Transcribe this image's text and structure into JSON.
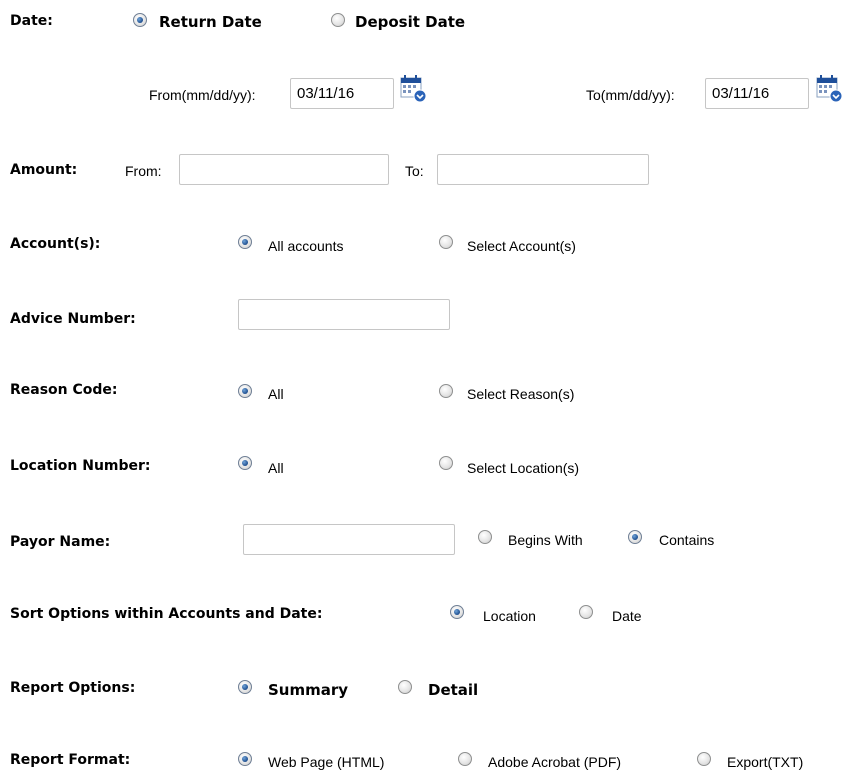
{
  "date": {
    "label": "Date:",
    "options": [
      "Return Date",
      "Deposit Date"
    ],
    "selected": "Return Date",
    "from_label": "From(mm/dd/yy):",
    "from_value": "03/11/16",
    "to_label": "To(mm/dd/yy):",
    "to_value": "03/11/16",
    "calendar_icon": "calendar-icon"
  },
  "amount": {
    "label": "Amount:",
    "from_label": "From:",
    "from_value": "",
    "to_label": "To:",
    "to_value": ""
  },
  "accounts": {
    "label": "Account(s):",
    "options": [
      "All accounts",
      "Select Account(s)"
    ],
    "selected": "All accounts"
  },
  "advice": {
    "label": "Advice Number:",
    "value": ""
  },
  "reason": {
    "label": "Reason Code:",
    "options": [
      "All",
      "Select Reason(s)"
    ],
    "selected": "All"
  },
  "location": {
    "label": "Location Number:",
    "options": [
      "All",
      "Select Location(s)"
    ],
    "selected": "All"
  },
  "payor": {
    "label": "Payor Name:",
    "value": "",
    "options": [
      "Begins With",
      "Contains"
    ],
    "selected": "Contains"
  },
  "sort": {
    "label": "Sort Options within Accounts and Date:",
    "options": [
      "Location",
      "Date"
    ],
    "selected": "Location"
  },
  "report_options": {
    "label": "Report Options:",
    "options": [
      "Summary",
      "Detail"
    ],
    "selected": "Summary"
  },
  "report_format": {
    "label": "Report Format:",
    "options": [
      "Web Page (HTML)",
      "Adobe Acrobat (PDF)",
      "Export(TXT)"
    ],
    "selected": "Web Page (HTML)"
  },
  "colors": {
    "radio_dot": "#1f4f8f",
    "calendar_blue": "#1f4f9a",
    "input_border": "#c6c6c6"
  }
}
